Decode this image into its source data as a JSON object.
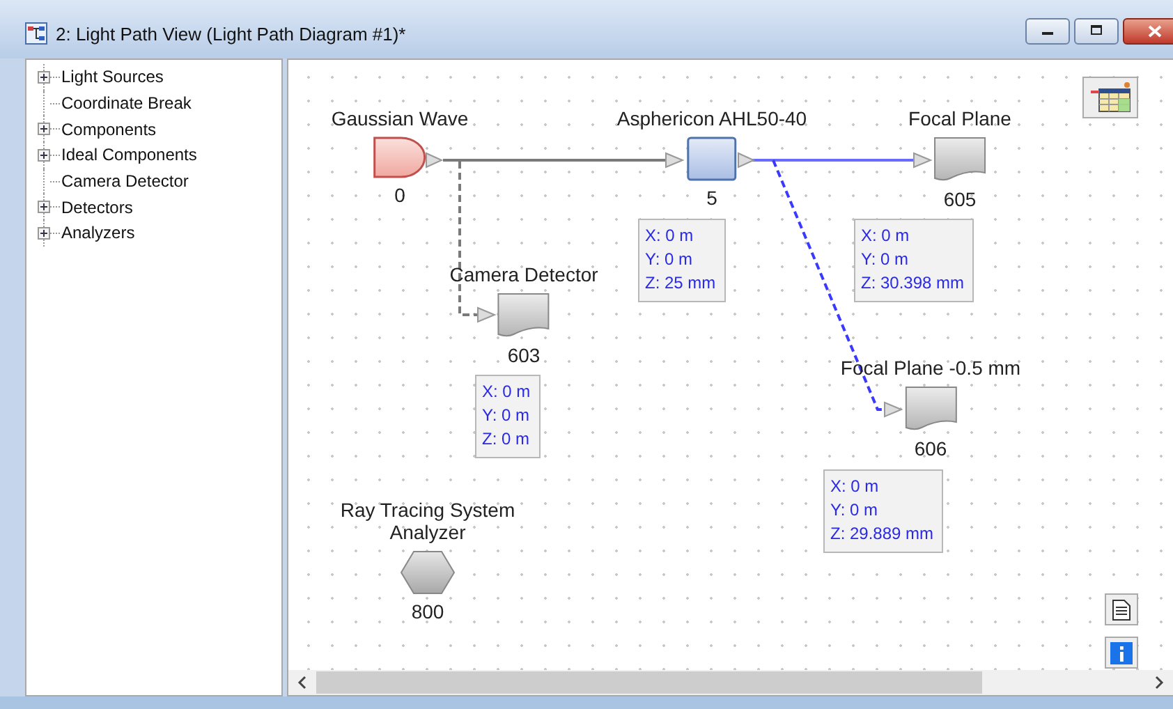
{
  "window": {
    "title": "2: Light Path View (Light Path Diagram #1)*"
  },
  "tree": [
    {
      "label": "Light Sources",
      "expandable": true
    },
    {
      "label": "Coordinate Break",
      "expandable": false
    },
    {
      "label": "Components",
      "expandable": true
    },
    {
      "label": "Ideal Components",
      "expandable": true
    },
    {
      "label": "Camera Detector",
      "expandable": false
    },
    {
      "label": "Detectors",
      "expandable": true
    },
    {
      "label": "Analyzers",
      "expandable": true
    }
  ],
  "nodes": [
    {
      "kind": "source",
      "label": "Gaussian Wave",
      "id": "0"
    },
    {
      "kind": "lens",
      "label": "Asphericon AHL50-40",
      "id": "5",
      "position": [
        "X: 0 m",
        "Y: 0 m",
        "Z: 25 mm"
      ]
    },
    {
      "kind": "detector",
      "label": "Focal Plane",
      "id": "605",
      "position": [
        "X: 0 m",
        "Y: 0 m",
        "Z: 30.398 mm"
      ]
    },
    {
      "kind": "detector",
      "label": "Camera Detector",
      "id": "603",
      "position": [
        "X: 0 m",
        "Y: 0 m",
        "Z: 0 m"
      ]
    },
    {
      "kind": "detector",
      "label": "Focal Plane -0.5 mm",
      "id": "606",
      "position": [
        "X: 0 m",
        "Y: 0 m",
        "Z: 29.889 mm"
      ]
    },
    {
      "kind": "analyzer",
      "label": "Ray Tracing System Analyzer",
      "id": "800"
    }
  ],
  "connections": [
    {
      "color": "#7a7a7a"
    },
    {
      "color": "#7a7a7a"
    },
    {
      "color": "#6a6aff"
    },
    {
      "color": "#3a3aff"
    }
  ]
}
